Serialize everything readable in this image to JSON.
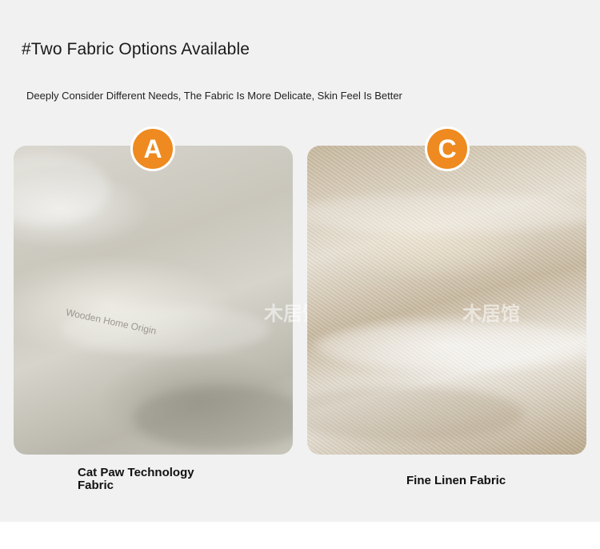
{
  "heading": "#Two Fabric Options Available",
  "subheading": "Deeply Consider Different Needs, The Fabric Is More Delicate, Skin Feel Is Better",
  "options": [
    {
      "badge": "A",
      "label": "Cat Paw Technology Fabric",
      "watermark": "Wooden Home Origin",
      "overlay_mark": "木居馆"
    },
    {
      "badge": "C",
      "label": "Fine Linen Fabric",
      "overlay_mark": "木居馆"
    }
  ],
  "colors": {
    "badge": "#ee8a1f",
    "panel_background": "#f1f1f1"
  }
}
